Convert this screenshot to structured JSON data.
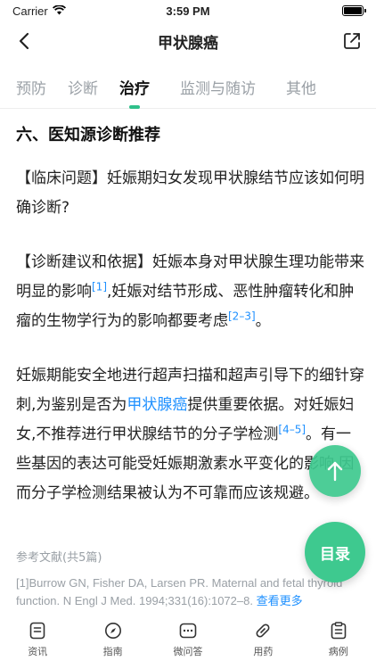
{
  "status_bar": {
    "carrier": "Carrier",
    "time": "3:59 PM"
  },
  "nav": {
    "title": "甲状腺癌"
  },
  "tabs": [
    {
      "label": "预防",
      "active": false
    },
    {
      "label": "诊断",
      "active": false
    },
    {
      "label": "治疗",
      "active": true
    },
    {
      "label": "监测与随访",
      "active": false
    },
    {
      "label": "其他",
      "active": false
    }
  ],
  "content": {
    "section_title": "六、医知源诊断推荐",
    "question": "【临床问题】妊娠期妇女发现甲状腺结节应该如何明确诊断?",
    "advice_part1": "【诊断建议和依据】妊娠本身对甲状腺生理功能带来明显的影响",
    "advice_cite1": "[1]",
    "advice_part2": ",妊娠对结节形成、恶性肿瘤转化和肿瘤的生物学行为的影响都要考虑",
    "advice_cite2": "[2–3]",
    "advice_part3": "。",
    "body_part1": "妊娠期能安全地进行超声扫描和超声引导下的细针穿刺,为鉴别是否为",
    "body_link": "甲状腺癌",
    "body_part2": "提供重要依据。对妊娠妇女,不推荐进行甲状腺结节的分子学检测",
    "body_cite": "[4–5]",
    "body_part3": "。有一些基因的表达可能受妊娠期激素水平变化的影响,因而分子学检测结果被认为不可靠而应该规避。"
  },
  "references": {
    "title": "参考文献(共5篇)",
    "first": "[1]Burrow GN, Fisher DA, Larsen PR. Maternal and fetal thyroid function. N Engl J Med. 1994;331(16):1072–8.",
    "more_label": "查看更多"
  },
  "fab": {
    "toc_label": "目录"
  },
  "bottom_nav": [
    {
      "label": "资讯",
      "icon": "news-icon"
    },
    {
      "label": "指南",
      "icon": "compass-icon"
    },
    {
      "label": "微问答",
      "icon": "chat-icon"
    },
    {
      "label": "用药",
      "icon": "pill-icon"
    },
    {
      "label": "病例",
      "icon": "clipboard-icon"
    }
  ],
  "colors": {
    "accent": "#3ec98f",
    "link": "#1e90ff"
  }
}
